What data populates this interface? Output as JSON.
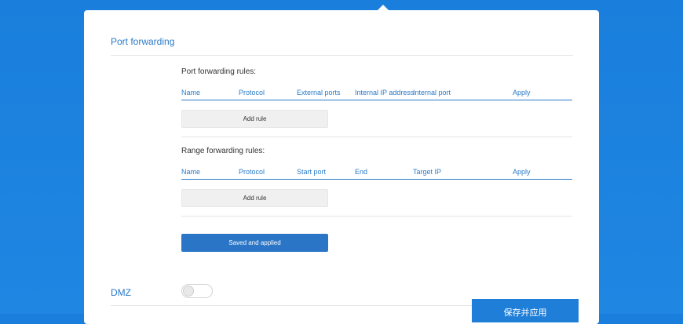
{
  "port_forwarding": {
    "title": "Port forwarding",
    "rules_title": "Port forwarding rules:",
    "columns": [
      "Name",
      "Protocol",
      "External ports",
      "Internal IP address",
      "Internal port",
      "Apply"
    ],
    "add_label": "Add rule"
  },
  "range_forwarding": {
    "title": "Range forwarding rules:",
    "columns": [
      "Name",
      "Protocol",
      "Start port",
      "End",
      "Target IP",
      "Apply"
    ],
    "add_label": "Add rule"
  },
  "save_label": "Saved and applied",
  "dmz": {
    "label": "DMZ",
    "enabled": false
  },
  "floating_button": {
    "label": "保存并应用"
  }
}
